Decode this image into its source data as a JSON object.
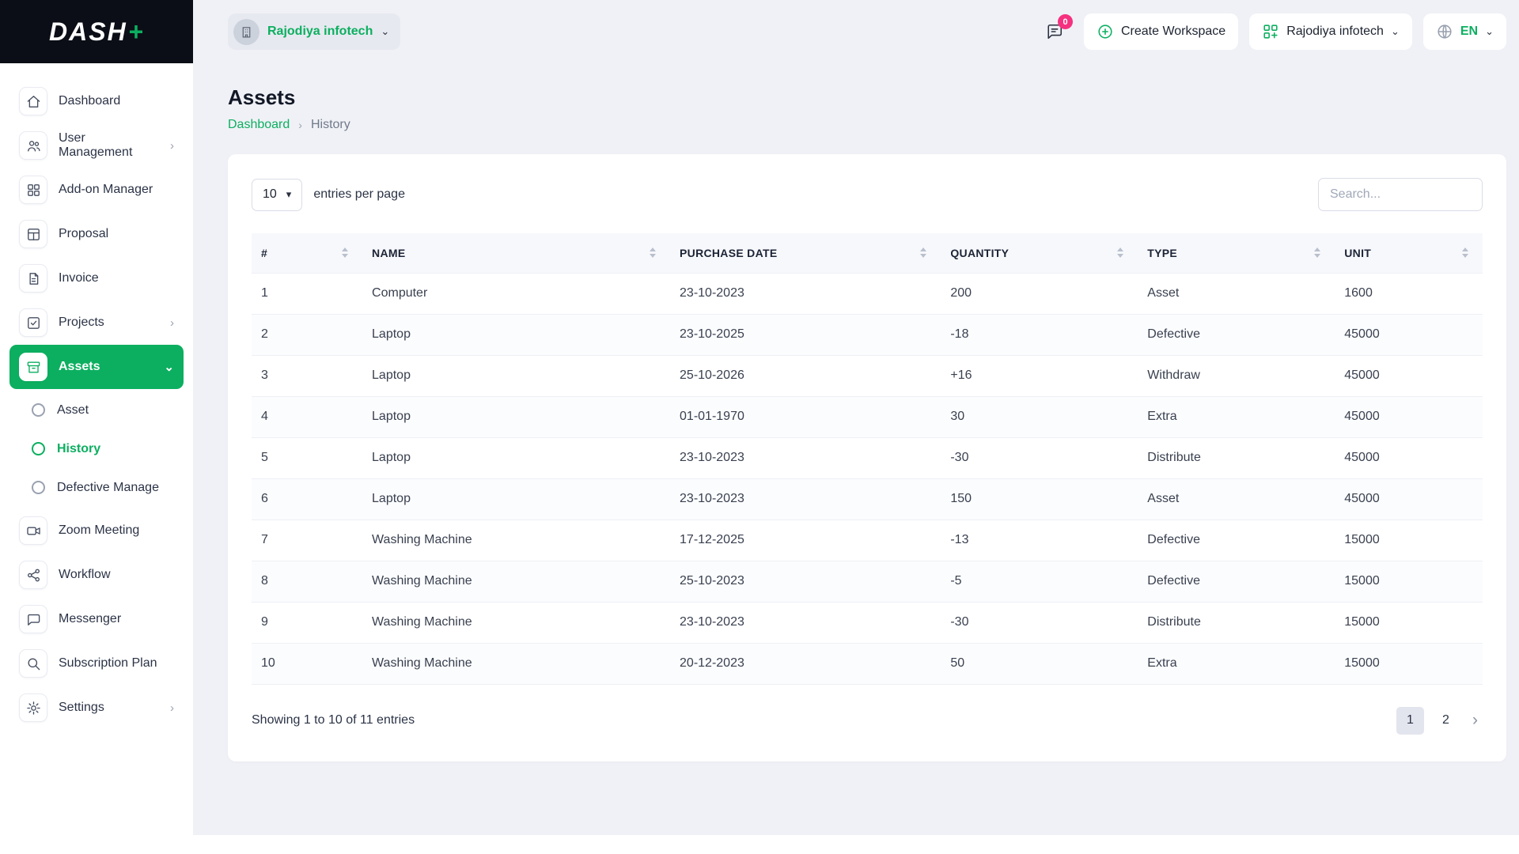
{
  "brand": {
    "logo_text": "DASH",
    "logo_accent": "+"
  },
  "icons": {
    "chevron_right": "›",
    "chevron_down": "⌄",
    "dropdown": "▾"
  },
  "topbar": {
    "workspace_pill": "Rajodiya infotech",
    "chat_badge": "0",
    "create_workspace_label": "Create Workspace",
    "account_pill": "Rajodiya infotech",
    "language_label": "EN"
  },
  "sidebar": {
    "items": [
      {
        "label": "Dashboard"
      },
      {
        "label": "User Management"
      },
      {
        "label": "Add-on Manager"
      },
      {
        "label": "Proposal"
      },
      {
        "label": "Invoice"
      },
      {
        "label": "Projects"
      },
      {
        "label": "Assets"
      },
      {
        "label": "Zoom Meeting"
      },
      {
        "label": "Workflow"
      },
      {
        "label": "Messenger"
      },
      {
        "label": "Subscription Plan"
      },
      {
        "label": "Settings"
      }
    ],
    "submenu": [
      {
        "label": "Asset"
      },
      {
        "label": "History"
      },
      {
        "label": "Defective Manage"
      }
    ]
  },
  "page": {
    "title": "Assets",
    "breadcrumb_home": "Dashboard",
    "breadcrumb_current": "History"
  },
  "controls": {
    "page_size": "10",
    "entries_label": "entries per page",
    "search_placeholder": "Search..."
  },
  "table": {
    "columns": [
      "#",
      "NAME",
      "PURCHASE DATE",
      "QUANTITY",
      "TYPE",
      "UNIT"
    ],
    "rows": [
      [
        "1",
        "Computer",
        "23-10-2023",
        "200",
        "Asset",
        "1600"
      ],
      [
        "2",
        "Laptop",
        "23-10-2025",
        "-18",
        "Defective",
        "45000"
      ],
      [
        "3",
        "Laptop",
        "25-10-2026",
        "+16",
        "Withdraw",
        "45000"
      ],
      [
        "4",
        "Laptop",
        "01-01-1970",
        "30",
        "Extra",
        "45000"
      ],
      [
        "5",
        "Laptop",
        "23-10-2023",
        "-30",
        "Distribute",
        "45000"
      ],
      [
        "6",
        "Laptop",
        "23-10-2023",
        "150",
        "Asset",
        "45000"
      ],
      [
        "7",
        "Washing Machine",
        "17-12-2025",
        "-13",
        "Defective",
        "15000"
      ],
      [
        "8",
        "Washing Machine",
        "25-10-2023",
        "-5",
        "Defective",
        "15000"
      ],
      [
        "9",
        "Washing Machine",
        "23-10-2023",
        "-30",
        "Distribute",
        "15000"
      ],
      [
        "10",
        "Washing Machine",
        "20-12-2023",
        "50",
        "Extra",
        "15000"
      ]
    ]
  },
  "footer": {
    "summary": "Showing 1 to 10 of 11 entries",
    "page1": "1",
    "page2": "2",
    "next": "›"
  },
  "colors": {
    "primary": "#0CAF60",
    "badge": "#F5317F",
    "brand_bg": "#0b0e16"
  }
}
